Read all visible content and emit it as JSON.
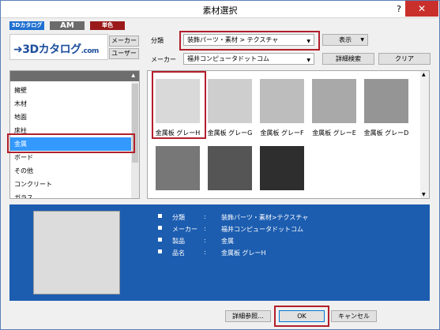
{
  "window": {
    "title": "素材選択",
    "help": "?",
    "close": "✕"
  },
  "tabs": [
    {
      "label": "3Dカタログ",
      "color": "#1e6fd0"
    },
    {
      "label": "AM",
      "color": "#6b6b6b"
    },
    {
      "label": "単色",
      "color": "#9a1a1a"
    }
  ],
  "logo": {
    "text": "3Dカタログ",
    "suffix": ".com"
  },
  "toolbar": {
    "maker_btn": "メーカー",
    "user_btn": "ユーザー",
    "category_label": "分類",
    "category_value": "装飾パーツ・素材 > テクスチャ",
    "maker_label": "メーカー",
    "maker_value": "福井コンピュータドットコム",
    "display_btn": "表示",
    "detail_search_btn": "詳細検索",
    "clear_btn": "クリア"
  },
  "categories": [
    "擁壁",
    "木材",
    "地面",
    "床柱",
    "金属",
    "ボード",
    "その他",
    "コンクリート",
    "ガラス"
  ],
  "selected_category": "金属",
  "materials": [
    {
      "label": "金属板 グレーH",
      "color": "#d9d9d9"
    },
    {
      "label": "金属板 グレーG",
      "color": "#cecece"
    },
    {
      "label": "金属板 グレーF",
      "color": "#bdbdbd"
    },
    {
      "label": "金属板 グレーE",
      "color": "#a9a9a9"
    },
    {
      "label": "金属板 グレーD",
      "color": "#959595"
    },
    {
      "label": "",
      "color": "#777777"
    },
    {
      "label": "",
      "color": "#555555"
    },
    {
      "label": "",
      "color": "#2e2e2e"
    }
  ],
  "info": {
    "rows": [
      {
        "key": "分類",
        "sep": ":",
        "value": "装飾パーツ・素材>テクスチャ"
      },
      {
        "key": "メーカー",
        "sep": ":",
        "value": "福井コンピュータドットコム"
      },
      {
        "key": "製品",
        "sep": ":",
        "value": "金属"
      },
      {
        "key": "品名",
        "sep": ":",
        "value": "金属板 グレーH"
      }
    ]
  },
  "footer": {
    "detail_ref": "詳細参照...",
    "ok": "OK",
    "cancel": "キャンセル"
  }
}
